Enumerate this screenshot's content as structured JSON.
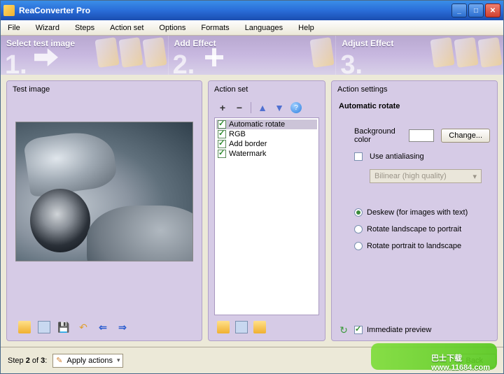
{
  "window": {
    "title": "ReaConverter Pro"
  },
  "menu": [
    "File",
    "Wizard",
    "Steps",
    "Action set",
    "Options",
    "Formats",
    "Languages",
    "Help"
  ],
  "ribbon": {
    "steps": [
      {
        "num": "1.",
        "title": "Select test image"
      },
      {
        "num": "2.",
        "title": "Add Effect"
      },
      {
        "num": "3.",
        "title": "Adjust Effect"
      }
    ]
  },
  "panels": {
    "test_image_label": "Test image",
    "action_set_label": "Action set",
    "action_settings_label": "Action settings"
  },
  "actions": {
    "items": [
      {
        "label": "Automatic rotate",
        "checked": true,
        "selected": true
      },
      {
        "label": "RGB",
        "checked": true,
        "selected": false
      },
      {
        "label": "Add border",
        "checked": true,
        "selected": false
      },
      {
        "label": "Watermark",
        "checked": true,
        "selected": false
      }
    ]
  },
  "settings": {
    "title": "Automatic rotate",
    "bg_label": "Background color",
    "bg_color": "#ffffff",
    "change_btn": "Change...",
    "aa_label": "Use antialiasing",
    "aa_checked": false,
    "aa_mode": "Bilinear (high quality)",
    "radio": [
      {
        "label": "Deskew (for images with text)",
        "on": true
      },
      {
        "label": "Rotate landscape to portrait",
        "on": false
      },
      {
        "label": "Rotate portrait to landscape",
        "on": false
      }
    ],
    "immediate_label": "Immediate preview",
    "immediate_on": true
  },
  "status": {
    "step_prefix": "Step ",
    "step_cur": "2",
    "step_mid": " of ",
    "step_total": "3",
    "step_suffix": ":",
    "combo_value": "Apply actions",
    "back_btn": "< Back"
  },
  "icons": {
    "plus": "+",
    "minus": "−",
    "up": "▲",
    "down": "▼",
    "help": "?",
    "undo": "↶",
    "prev": "⇐",
    "next": "⇒",
    "save": "💾",
    "caret": "▾",
    "refresh": "↻"
  },
  "watermark": {
    "url": "www.11684.com",
    "brand": "巴士下载"
  }
}
